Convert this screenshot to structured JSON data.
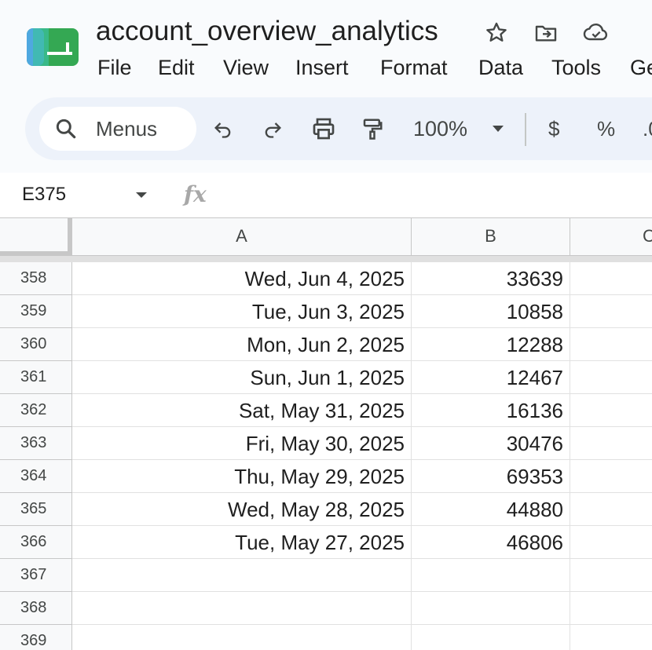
{
  "document": {
    "title": "account_overview_analytics",
    "title_icons": [
      "star-icon",
      "move-to-folder-icon",
      "cloud-saved-icon"
    ]
  },
  "menu": [
    "File",
    "Edit",
    "View",
    "Insert",
    "Format",
    "Data",
    "Tools",
    "Ge"
  ],
  "toolbar": {
    "search_label": "Menus",
    "zoom": "100%",
    "currency": "$",
    "percent": "%",
    "decimal": ".0"
  },
  "formula_bar": {
    "name_box": "E375",
    "fx": "fx"
  },
  "grid": {
    "columns": [
      "A",
      "B",
      "C"
    ],
    "rows": [
      {
        "num": "358",
        "a": "Wed, Jun 4, 2025",
        "b": "33639"
      },
      {
        "num": "359",
        "a": "Tue, Jun 3, 2025",
        "b": "10858"
      },
      {
        "num": "360",
        "a": "Mon, Jun 2, 2025",
        "b": "12288"
      },
      {
        "num": "361",
        "a": "Sun, Jun 1, 2025",
        "b": "12467"
      },
      {
        "num": "362",
        "a": "Sat, May 31, 2025",
        "b": "16136"
      },
      {
        "num": "363",
        "a": "Fri, May 30, 2025",
        "b": "30476"
      },
      {
        "num": "364",
        "a": "Thu, May 29, 2025",
        "b": "69353"
      },
      {
        "num": "365",
        "a": "Wed, May 28, 2025",
        "b": "44880"
      },
      {
        "num": "366",
        "a": "Tue, May 27, 2025",
        "b": "46806"
      },
      {
        "num": "367",
        "a": "",
        "b": ""
      },
      {
        "num": "368",
        "a": "",
        "b": ""
      },
      {
        "num": "369",
        "a": "",
        "b": ""
      }
    ]
  },
  "colors": {
    "accent": "#0b57d0",
    "logo_green": "#34a853",
    "header_bg": "#f8f9fa",
    "toolbar_bg": "#edf2fa"
  }
}
